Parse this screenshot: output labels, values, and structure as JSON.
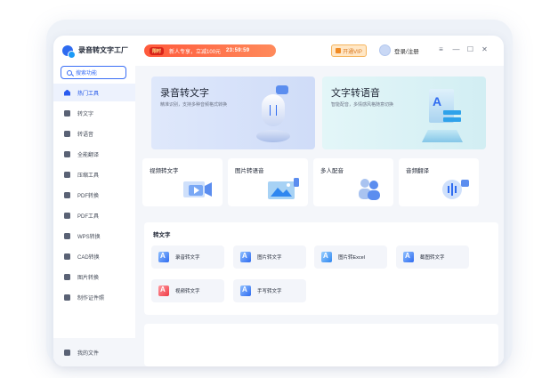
{
  "app": {
    "title": "录音转文字工厂"
  },
  "promo": {
    "tag": "限时",
    "text": "新人专享，立减100元",
    "timer": "23:59:59"
  },
  "header": {
    "vip_label": "开通VIP",
    "login_label": "登录/注册",
    "menu_icon": "menu-icon",
    "minimize_icon": "minimize-icon",
    "maximize_icon": "maximize-icon",
    "close_icon": "close-icon"
  },
  "sidebar": {
    "search_label": "搜索功能",
    "items": [
      {
        "label": "热门工具",
        "icon": "home-icon",
        "active": true
      },
      {
        "label": "转文字",
        "icon": "text-icon"
      },
      {
        "label": "转语音",
        "icon": "voice-icon"
      },
      {
        "label": "全能翻译",
        "icon": "translate-icon"
      },
      {
        "label": "压缩工具",
        "icon": "compress-icon"
      },
      {
        "label": "PDF转换",
        "icon": "pdf-convert-icon"
      },
      {
        "label": "PDF工具",
        "icon": "pdf-tool-icon"
      },
      {
        "label": "WPS转换",
        "icon": "wps-icon"
      },
      {
        "label": "CAD转换",
        "icon": "cad-icon"
      },
      {
        "label": "图片转换",
        "icon": "image-icon"
      },
      {
        "label": "制作证件照",
        "icon": "id-photo-icon"
      }
    ],
    "bottom_item": {
      "label": "我的文件",
      "icon": "file-icon"
    }
  },
  "hero": [
    {
      "title": "录音转文字",
      "subtitle": "精准识别，支持多种音频格式转换"
    },
    {
      "title": "文字转语音",
      "subtitle": "智能配音，多情感风格随意切换"
    }
  ],
  "tiles": [
    {
      "label": "视频转文字"
    },
    {
      "label": "图片转语音"
    },
    {
      "label": "多人配音"
    },
    {
      "label": "音频翻译"
    }
  ],
  "section": {
    "title": "转文字",
    "features": [
      {
        "label": "录音转文字"
      },
      {
        "label": "图片转文字"
      },
      {
        "label": "图片转Excel"
      },
      {
        "label": "截图转文字"
      },
      {
        "label": "视频转文字"
      },
      {
        "label": "手写转文字"
      }
    ]
  },
  "colors": {
    "accent": "#2F6BF0",
    "promo": "#FF5A3C",
    "vip": "#F08A24"
  }
}
